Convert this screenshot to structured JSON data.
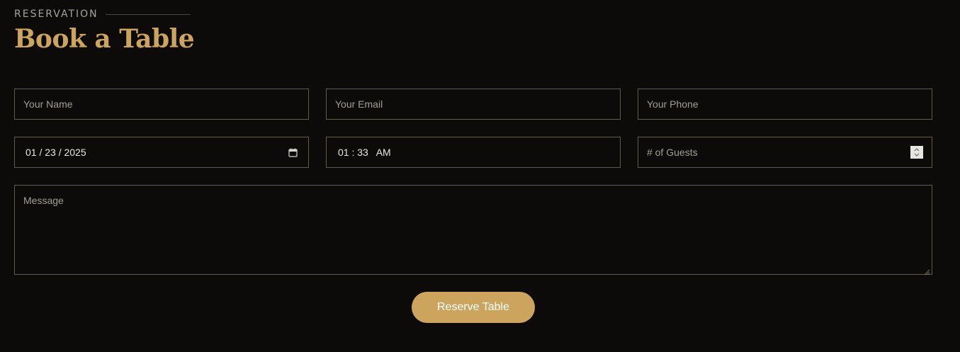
{
  "section": {
    "eyebrow": "RESERVATION",
    "title": "Book a Table"
  },
  "form": {
    "name_placeholder": "Your Name",
    "email_placeholder": "Your Email",
    "phone_placeholder": "Your Phone",
    "date_value": "01 / 23 / 2025",
    "time_value": "01 : 33   AM",
    "guests_placeholder": "# of Guests",
    "message_placeholder": "Message",
    "submit_label": "Reserve Table"
  },
  "colors": {
    "background": "#0c0b0a",
    "accent": "#cda45e",
    "border": "#625b4b",
    "placeholder": "#a49e93"
  },
  "icons": {
    "date": "calendar-icon",
    "guests": "number-stepper-icon",
    "message": "resize-handle-icon"
  }
}
